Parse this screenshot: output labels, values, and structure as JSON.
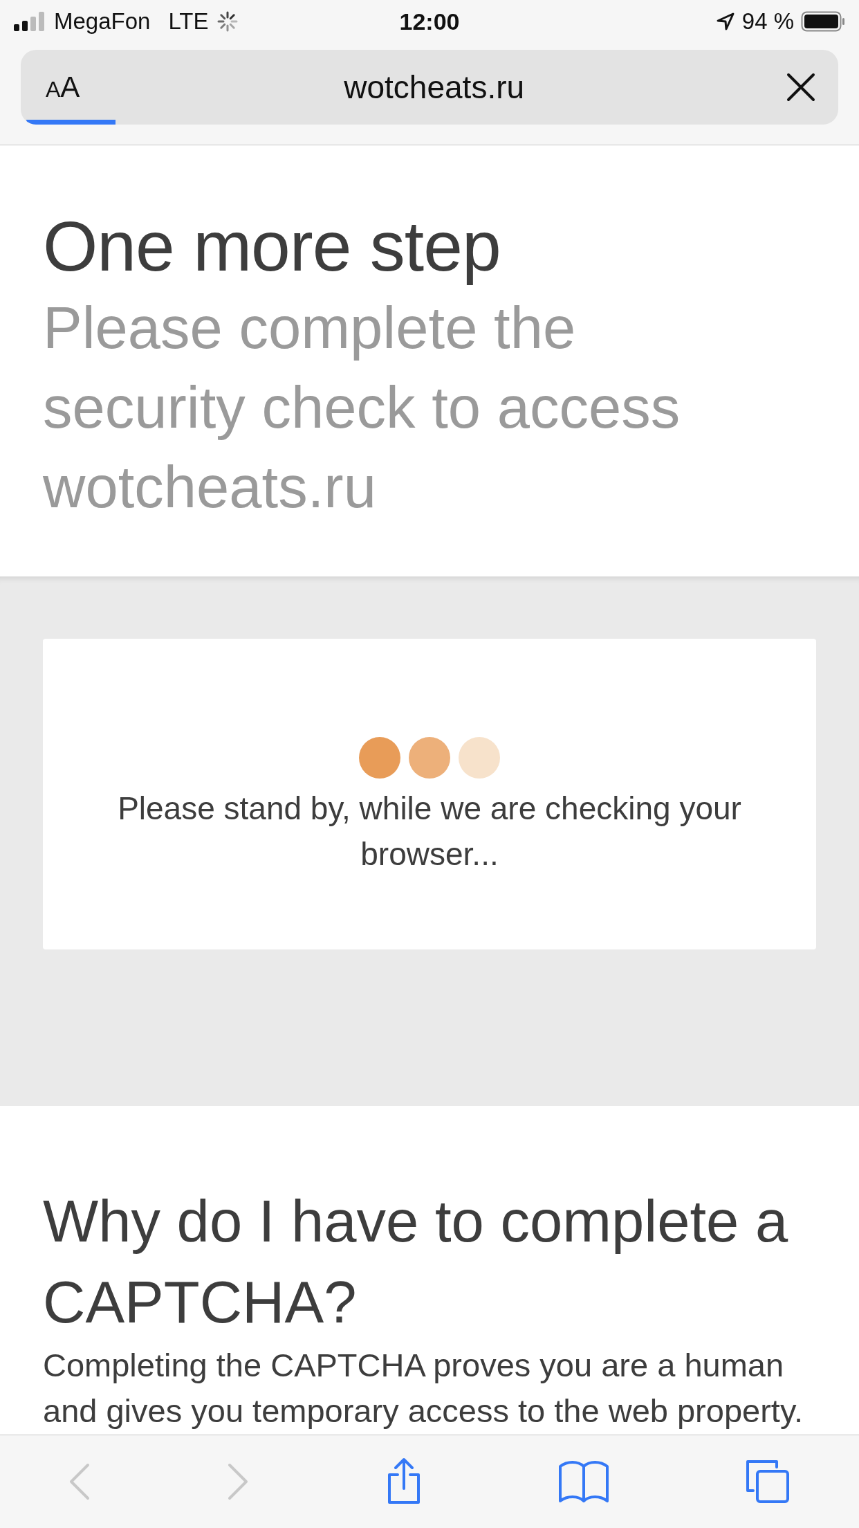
{
  "status_bar": {
    "carrier": "MegaFon",
    "network": "LTE",
    "time": "12:00",
    "battery": "94 %"
  },
  "address_bar": {
    "text_size_button": "AA",
    "url": "wotcheats.ru"
  },
  "header": {
    "title": "One more step",
    "subtitle": "Please complete the security check to access wotcheats.ru"
  },
  "check_card": {
    "dots": [
      {
        "color": "#e89c58"
      },
      {
        "color": "#edb07a"
      },
      {
        "color": "#f7e2cb"
      }
    ],
    "message": "Please stand by, while we are checking your browser..."
  },
  "why_section": {
    "heading": "Why do I have to complete a CAPTCHA?",
    "text": "Completing the CAPTCHA proves you are a human and gives you temporary access to the web property."
  },
  "toolbar": [
    {
      "kind": "back",
      "disabled": true
    },
    {
      "kind": "forward",
      "disabled": true
    },
    {
      "kind": "share",
      "disabled": false
    },
    {
      "kind": "bookmarks",
      "disabled": false
    },
    {
      "kind": "tabs",
      "disabled": false
    }
  ]
}
